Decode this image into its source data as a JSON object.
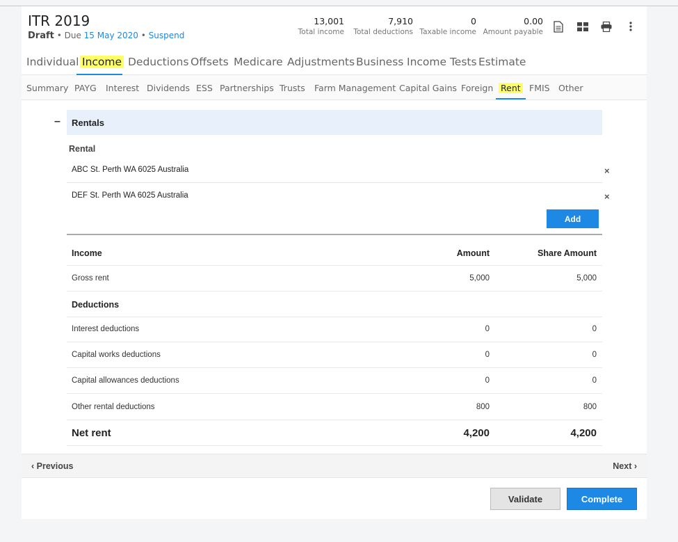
{
  "header": {
    "title": "ITR 2019",
    "status": "Draft",
    "due_prefix": "Due",
    "due_date": "15 May 2020",
    "suspend": "Suspend",
    "stats": [
      {
        "value": "13,001",
        "label": "Total income"
      },
      {
        "value": "7,910",
        "label": "Total deductions"
      },
      {
        "value": "0",
        "label": "Taxable income"
      },
      {
        "value": "0.00",
        "label": "Amount payable"
      }
    ],
    "icons": [
      "document-icon",
      "grid-icon",
      "print-icon",
      "more-vertical-icon"
    ]
  },
  "main_tabs": [
    "Individual",
    "Income",
    "Deductions",
    "Offsets",
    "Medicare",
    "Adjustments",
    "Business",
    "Income Tests",
    "Estimate"
  ],
  "main_tab_active": "Income",
  "sub_tabs": [
    "Summary",
    "PAYG",
    "Interest",
    "Dividends",
    "ESS",
    "Partnerships",
    "Trusts",
    "Farm Management",
    "Capital Gains",
    "Foreign",
    "Rent",
    "FMIS",
    "Other"
  ],
  "sub_tab_active": "Rent",
  "section": {
    "collapse_symbol": "–",
    "title": "Rentals",
    "rental_label": "Rental",
    "addresses": [
      "ABC St. Perth WA 6025 Australia",
      "DEF St. Perth WA 6025 Australia"
    ],
    "remove_symbol": "×",
    "add_label": "Add"
  },
  "table": {
    "headers": {
      "income": "Income",
      "amount": "Amount",
      "share": "Share Amount"
    },
    "gross_rent": {
      "label": "Gross rent",
      "amount": "5,000",
      "share": "5,000"
    },
    "deductions_heading": "Deductions",
    "deductions": [
      {
        "label": "Interest deductions",
        "amount": "0",
        "share": "0"
      },
      {
        "label": "Capital works deductions",
        "amount": "0",
        "share": "0"
      },
      {
        "label": "Capital allowances deductions",
        "amount": "0",
        "share": "0"
      },
      {
        "label": "Other rental deductions",
        "amount": "800",
        "share": "800"
      }
    ],
    "net_rent": {
      "label": "Net rent",
      "amount": "4,200",
      "share": "4,200"
    }
  },
  "nav": {
    "previous": "‹ Previous",
    "next": "Next ›"
  },
  "actions": {
    "validate": "Validate",
    "complete": "Complete"
  },
  "colors": {
    "accent": "#1e88e5",
    "highlight": "#ffff66"
  }
}
